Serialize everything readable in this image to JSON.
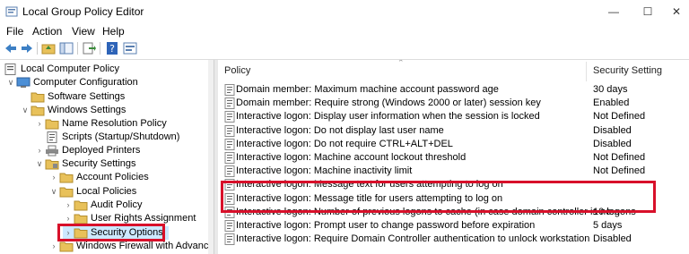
{
  "window": {
    "title": "Local Group Policy Editor",
    "minimize_glyph": "—",
    "maximize_glyph": "☐",
    "close_glyph": "✕"
  },
  "menu": [
    "File",
    "Action",
    "View",
    "Help"
  ],
  "toolbar": {
    "icons": [
      "back-arrow-icon",
      "forward-arrow-icon",
      "up-folder-icon",
      "show-hide-tree-icon",
      "export-list-icon",
      "help-icon",
      "properties-icon"
    ]
  },
  "tree": {
    "items": [
      {
        "label": "Local Computer Policy",
        "icon": "computer-policy-icon",
        "level": 0,
        "chevron": ""
      },
      {
        "label": "Computer Configuration",
        "icon": "computer-icon",
        "level": 1,
        "chevron": "v"
      },
      {
        "label": "Software Settings",
        "icon": "folder-icon",
        "level": 2,
        "chevron": ""
      },
      {
        "label": "Windows Settings",
        "icon": "folder-icon",
        "level": 2,
        "chevron": "v"
      },
      {
        "label": "Name Resolution Policy",
        "icon": "folder-icon",
        "level": 3,
        "chevron": ">"
      },
      {
        "label": "Scripts (Startup/Shutdown)",
        "icon": "script-icon",
        "level": 3,
        "chevron": ""
      },
      {
        "label": "Deployed Printers",
        "icon": "printer-icon",
        "level": 3,
        "chevron": ">"
      },
      {
        "label": "Security Settings",
        "icon": "security-icon",
        "level": 3,
        "chevron": "v"
      },
      {
        "label": "Account Policies",
        "icon": "folder-icon",
        "level": 4,
        "chevron": ">"
      },
      {
        "label": "Local Policies",
        "icon": "folder-icon",
        "level": 4,
        "chevron": "v"
      },
      {
        "label": "Audit Policy",
        "icon": "folder-icon",
        "level": 5,
        "chevron": ">"
      },
      {
        "label": "User Rights Assignment",
        "icon": "folder-icon",
        "level": 5,
        "chevron": ">"
      },
      {
        "label": "Security Options",
        "icon": "folder-icon",
        "level": 5,
        "chevron": ">"
      },
      {
        "label": "Windows Firewall with Advance",
        "icon": "folder-icon",
        "level": 4,
        "chevron": ">"
      }
    ]
  },
  "list": {
    "columns": [
      "Policy",
      "Security Setting"
    ],
    "rows": [
      {
        "policy": "Domain member: Maximum machine account password age",
        "setting": "30 days"
      },
      {
        "policy": "Domain member: Require strong (Windows 2000 or later) session key",
        "setting": "Enabled"
      },
      {
        "policy": "Interactive logon: Display user information when the session is locked",
        "setting": "Not Defined"
      },
      {
        "policy": "Interactive logon: Do not display last user name",
        "setting": "Disabled"
      },
      {
        "policy": "Interactive logon: Do not require CTRL+ALT+DEL",
        "setting": "Disabled"
      },
      {
        "policy": "Interactive logon: Machine account lockout threshold",
        "setting": "Not Defined"
      },
      {
        "policy": "Interactive logon: Machine inactivity limit",
        "setting": "Not Defined"
      },
      {
        "policy": "Interactive logon: Message text for users attempting to log on",
        "setting": ""
      },
      {
        "policy": "Interactive logon: Message title for users attempting to log on",
        "setting": ""
      },
      {
        "policy": "Interactive logon: Number of previous logons to cache (in case domain controller is no...",
        "setting": "10 logons"
      },
      {
        "policy": "Interactive logon: Prompt user to change password before expiration",
        "setting": "5 days"
      },
      {
        "policy": "Interactive logon: Require Domain Controller authentication to unlock workstation",
        "setting": "Disabled"
      }
    ]
  },
  "colors": {
    "highlight": "#d8102a",
    "folder": "#e8c15a",
    "selection": "#cce8ff"
  }
}
